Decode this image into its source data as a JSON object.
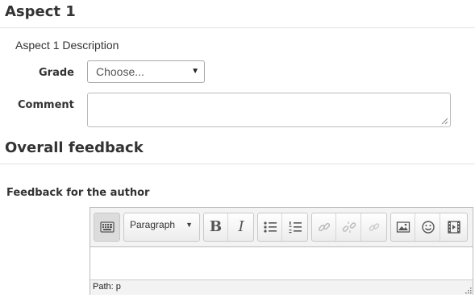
{
  "aspect": {
    "title": "Aspect 1",
    "description": "Aspect 1 Description",
    "grade_label": "Grade",
    "grade_value": "Choose...",
    "comment_label": "Comment"
  },
  "overall": {
    "title": "Overall feedback",
    "feedback_label": "Feedback for the author"
  },
  "editor": {
    "format_value": "Paragraph",
    "toolbar_icons": [
      "toolbar-toggle-icon",
      "bold-icon",
      "italic-icon",
      "bullet-list-icon",
      "numbered-list-icon",
      "link-icon",
      "unlink-icon",
      "no-autolink-icon",
      "image-icon",
      "emoticon-icon",
      "media-icon"
    ],
    "bold_glyph": "B",
    "italic_glyph": "I",
    "status_path": "Path: p"
  }
}
